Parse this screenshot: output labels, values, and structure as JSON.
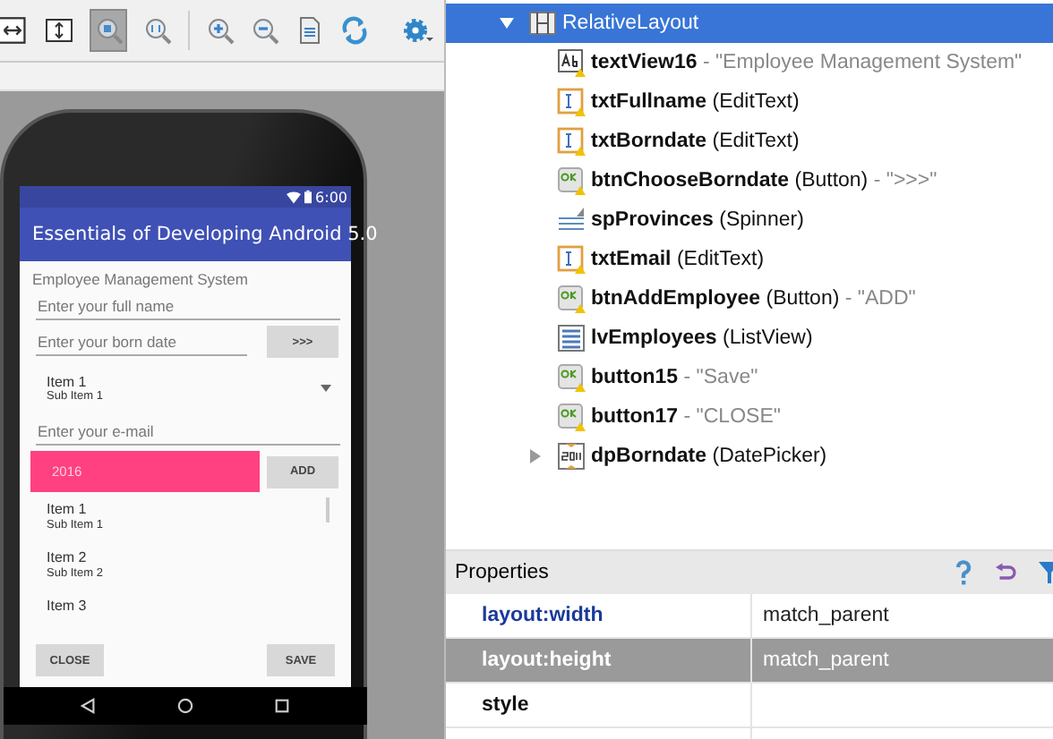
{
  "phone": {
    "status_time": "6:00",
    "app_title": "Essentials of Developing Android 5.0",
    "heading": "Employee Management System",
    "fullname": {
      "placeholder": "Enter your full name"
    },
    "borndate": {
      "placeholder": "Enter your born date"
    },
    "choose_button": ">>>",
    "spinner": {
      "title": "Item 1",
      "subtitle": "Sub Item 1"
    },
    "email": {
      "placeholder": "Enter your e-mail"
    },
    "date_picker": "2016",
    "add_button": "ADD",
    "list_items": [
      {
        "title": "Item 1",
        "subtitle": "Sub Item 1"
      },
      {
        "title": "Item 2",
        "subtitle": "Sub Item 2"
      },
      {
        "title": "Item 3"
      }
    ],
    "close_button": "CLOSE",
    "save_button": "SAVE"
  },
  "outline": [
    {
      "name": "RelativeLayout",
      "kind": "layout",
      "expanded": true,
      "selected": true,
      "children": [
        {
          "name": "textView16",
          "kind": "textview",
          "value": "- \"Employee Management System\"",
          "selected": false
        },
        {
          "name": "txtFullname",
          "kind": "edittext",
          "type": "(EditText)",
          "selected": false
        },
        {
          "name": "txtBorndate",
          "kind": "edittext",
          "type": "(EditText)",
          "selected": false
        },
        {
          "name": "btnChooseBorndate",
          "kind": "button",
          "type": "(Button)",
          "value": "- \">>>\"",
          "selected": false
        },
        {
          "name": "spProvinces",
          "kind": "spinner",
          "type": "(Spinner)",
          "selected": false
        },
        {
          "name": "txtEmail",
          "kind": "edittext",
          "type": "(EditText)",
          "selected": false
        },
        {
          "name": "btnAddEmployee",
          "kind": "button",
          "type": "(Button)",
          "value": "- \"ADD\"",
          "selected": false
        },
        {
          "name": "lvEmployees",
          "kind": "listview",
          "type": "(ListView)",
          "selected": false
        },
        {
          "name": "button15",
          "kind": "button",
          "value": "- \"Save\"",
          "selected": false
        },
        {
          "name": "button17",
          "kind": "button",
          "value": "- \"CLOSE\"",
          "selected": false
        },
        {
          "name": "dpBorndate",
          "kind": "datepicker",
          "type": "(DatePicker)",
          "expanded": false,
          "selected": false
        }
      ]
    }
  ],
  "properties": {
    "title": "Properties",
    "rows": [
      {
        "name": "layout:width",
        "value": "match_parent",
        "modified": true,
        "selected": false
      },
      {
        "name": "layout:height",
        "value": "match_parent",
        "modified": true,
        "selected": true
      },
      {
        "name": "style",
        "modified": false,
        "selected": false
      }
    ]
  }
}
